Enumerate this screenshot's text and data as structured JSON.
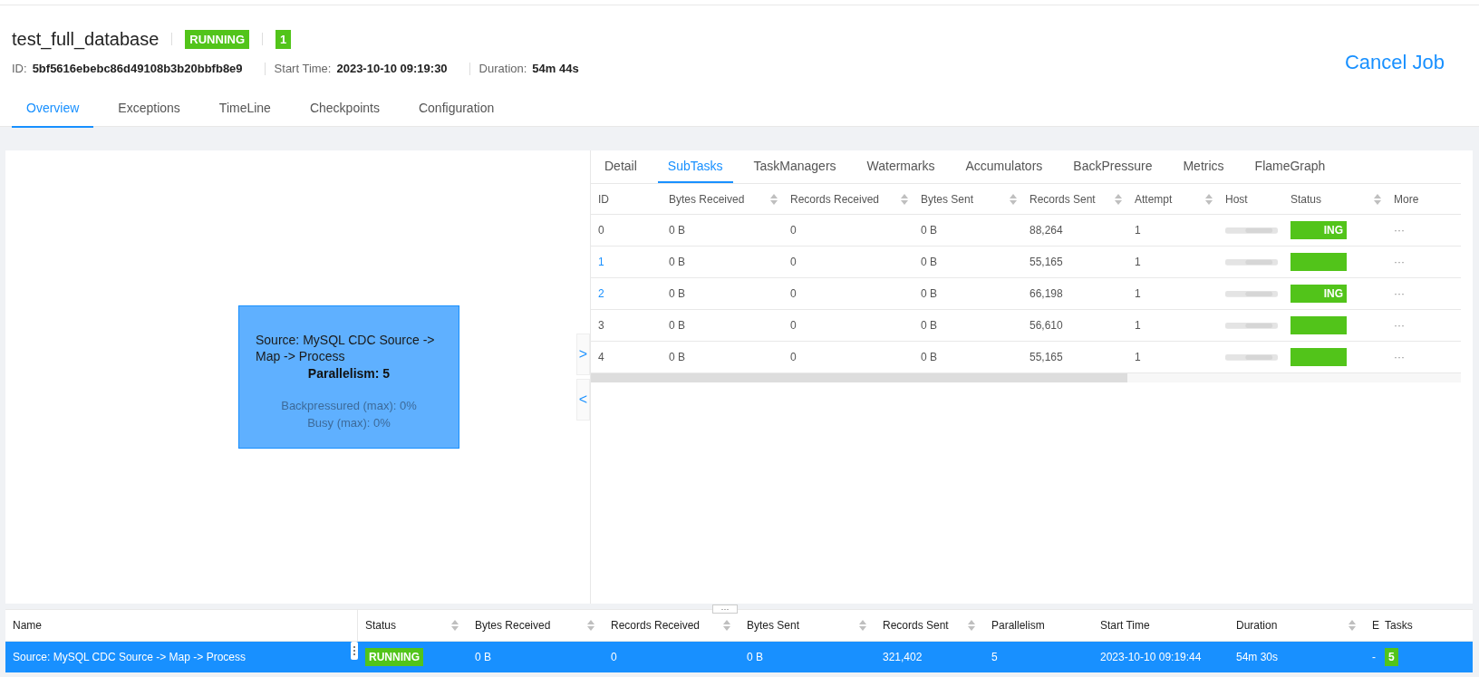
{
  "job": {
    "name": "test_full_database",
    "status": "RUNNING",
    "count": "1",
    "id_label": "ID:",
    "id": "5bf5616ebebc86d49108b3b20bbfb8e9",
    "start_label": "Start Time:",
    "start": "2023-10-10 09:19:30",
    "duration_label": "Duration:",
    "duration": "54m 44s",
    "cancel": "Cancel Job"
  },
  "tabs": [
    {
      "label": "Overview",
      "selected": true
    },
    {
      "label": "Exceptions",
      "selected": false
    },
    {
      "label": "TimeLine",
      "selected": false
    },
    {
      "label": "Checkpoints",
      "selected": false
    },
    {
      "label": "Configuration",
      "selected": false
    }
  ],
  "graph": {
    "node": {
      "title": "Source: MySQL CDC Source -> Map -> Process",
      "parallelism": "Parallelism: 5",
      "backpressured": "Backpressured (max): 0%",
      "busy": "Busy (max): 0%"
    },
    "expand": ">",
    "collapse": "<"
  },
  "detail_tabs": [
    {
      "label": "Detail",
      "selected": false
    },
    {
      "label": "SubTasks",
      "selected": true
    },
    {
      "label": "TaskManagers",
      "selected": false
    },
    {
      "label": "Watermarks",
      "selected": false
    },
    {
      "label": "Accumulators",
      "selected": false
    },
    {
      "label": "BackPressure",
      "selected": false
    },
    {
      "label": "Metrics",
      "selected": false
    },
    {
      "label": "FlameGraph",
      "selected": false
    }
  ],
  "subtasks": {
    "columns": [
      {
        "label": "ID",
        "sortable": false
      },
      {
        "label": "Bytes Received",
        "sortable": true
      },
      {
        "label": "Records Received",
        "sortable": true
      },
      {
        "label": "Bytes Sent",
        "sortable": true
      },
      {
        "label": "Records Sent",
        "sortable": true
      },
      {
        "label": "Attempt",
        "sortable": true
      },
      {
        "label": "Host",
        "sortable": false
      },
      {
        "label": "Status",
        "sortable": true
      },
      {
        "label": "More",
        "sortable": false
      }
    ],
    "rows": [
      {
        "id": "0",
        "bytes_received": "0 B",
        "records_received": "0",
        "bytes_sent": "0 B",
        "records_sent": "88,264",
        "attempt": "1",
        "status": "ING",
        "more": "···"
      },
      {
        "id": "1",
        "bytes_received": "0 B",
        "records_received": "0",
        "bytes_sent": "0 B",
        "records_sent": "55,165",
        "attempt": "1",
        "more": "···"
      },
      {
        "id": "2",
        "bytes_received": "0 B",
        "records_received": "0",
        "bytes_sent": "0 B",
        "records_sent": "66,198",
        "attempt": "1",
        "status": "ING",
        "more": "···"
      },
      {
        "id": "3",
        "bytes_received": "0 B",
        "records_received": "0",
        "bytes_sent": "0 B",
        "records_sent": "56,610",
        "attempt": "1",
        "more": "···"
      },
      {
        "id": "4",
        "bytes_received": "0 B",
        "records_received": "0",
        "bytes_sent": "0 B",
        "records_sent": "55,165",
        "attempt": "1",
        "more": "···"
      }
    ]
  },
  "splitter": "···",
  "vertices": {
    "columns": [
      {
        "label": "Name",
        "sortable": false
      },
      {
        "label": "Status",
        "sortable": true
      },
      {
        "label": "Bytes Received",
        "sortable": true
      },
      {
        "label": "Records Received",
        "sortable": true
      },
      {
        "label": "Bytes Sent",
        "sortable": true
      },
      {
        "label": "Records Sent",
        "sortable": true
      },
      {
        "label": "Parallelism",
        "sortable": false
      },
      {
        "label": "Start Time",
        "sortable": false
      },
      {
        "label": "Duration",
        "sortable": true
      },
      {
        "label": "E"
      },
      {
        "label": "Tasks",
        "sortable": false
      }
    ],
    "rows": [
      {
        "name": "Source: MySQL CDC Source -> Map -> Process",
        "status": "RUNNING",
        "bytes_received": "0 B",
        "records_received": "0",
        "bytes_sent": "0 B",
        "records_sent": "321,402",
        "parallelism": "5",
        "start_time": "2023-10-10 09:19:44",
        "duration": "54m 30s",
        "end": "-",
        "tasks": "5",
        "selected": true
      }
    ]
  }
}
